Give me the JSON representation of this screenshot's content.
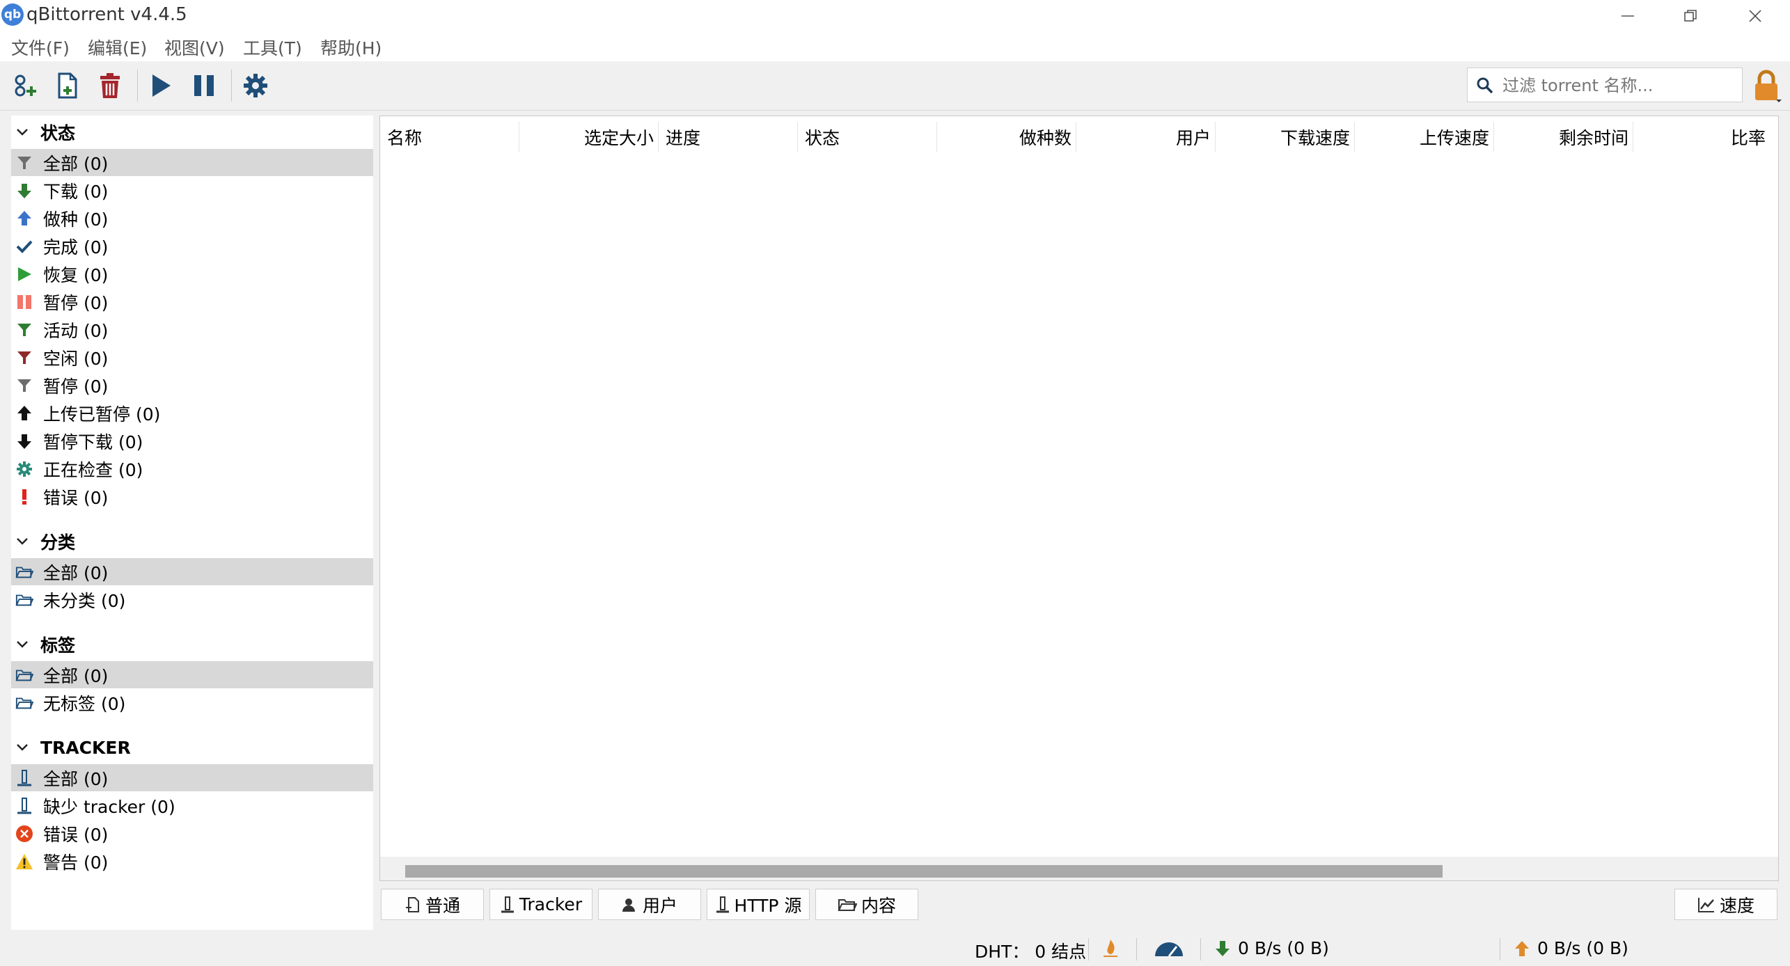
{
  "window": {
    "app_icon_text": "qb",
    "title": "qBittorrent v4.4.5"
  },
  "menu": [
    "文件(F)",
    "编辑(E)",
    "视图(V)",
    "工具(T)",
    "帮助(H)"
  ],
  "toolbar": {
    "search_placeholder": "过滤 torrent 名称..."
  },
  "sidebar": {
    "status": {
      "title": "状态",
      "items": [
        "全部 (0)",
        "下载 (0)",
        "做种 (0)",
        "完成 (0)",
        "恢复 (0)",
        "暂停 (0)",
        "活动 (0)",
        "空闲 (0)",
        "暂停 (0)",
        "上传已暂停 (0)",
        "暂停下载 (0)",
        "正在检查 (0)",
        "错误 (0)"
      ]
    },
    "categories": {
      "title": "分类",
      "items": [
        "全部 (0)",
        "未分类 (0)"
      ]
    },
    "tags": {
      "title": "标签",
      "items": [
        "全部 (0)",
        "无标签 (0)"
      ]
    },
    "trackers": {
      "title": "TRACKER",
      "items": [
        "全部 (0)",
        "缺少 tracker (0)",
        "错误 (0)",
        "警告 (0)"
      ]
    }
  },
  "table": {
    "columns": [
      "名称",
      "选定大小",
      "进度",
      "状态",
      "做种数",
      "用户",
      "下载速度",
      "上传速度",
      "剩余时间",
      "比率"
    ],
    "rows": []
  },
  "bottom_tabs": [
    "普通",
    "Tracker",
    "用户",
    "HTTP 源",
    "内容"
  ],
  "speed_button": "速度",
  "status_bar": {
    "dht": "DHT： 0 结点",
    "download": "0 B/s (0 B)",
    "upload": "0 B/s (0 B)"
  },
  "colors": {
    "selected_row": "#d8d8d8",
    "download_green": "#2e7d32",
    "upload_orange": "#e08a2c",
    "delete_red": "#a4262c",
    "accent_blue": "#1f4e79"
  }
}
